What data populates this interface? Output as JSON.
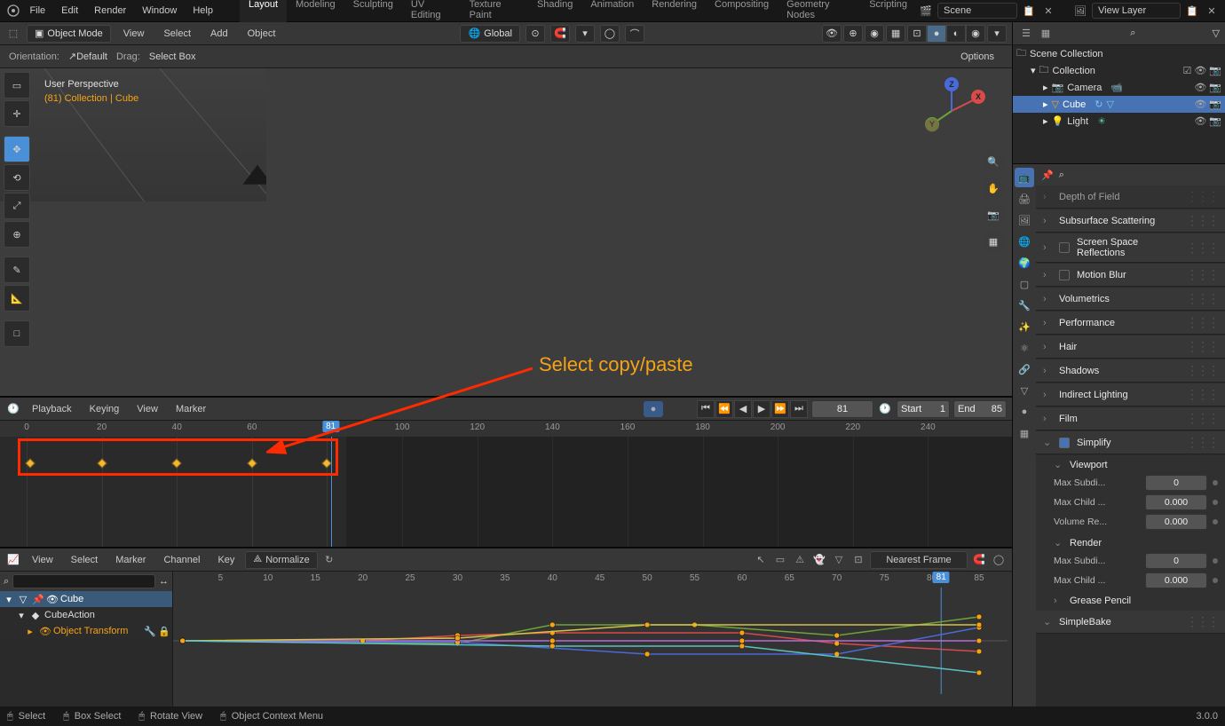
{
  "topbar": {
    "menus": [
      "File",
      "Edit",
      "Render",
      "Window",
      "Help"
    ],
    "tabs": [
      "Layout",
      "Modeling",
      "Sculpting",
      "UV Editing",
      "Texture Paint",
      "Shading",
      "Animation",
      "Rendering",
      "Compositing",
      "Geometry Nodes",
      "Scripting"
    ],
    "active_tab": 0,
    "scene_label": "Scene",
    "viewlayer_label": "View Layer"
  },
  "header3d": {
    "mode": "Object Mode",
    "menus": [
      "View",
      "Select",
      "Add",
      "Object"
    ],
    "orientation": "Global",
    "orientation_label": "Orientation:",
    "orientation_value": "Default",
    "drag_label": "Drag:",
    "drag_value": "Select Box",
    "options": "Options"
  },
  "overlay": {
    "line1": "User Perspective",
    "line2": "(81) Collection | Cube"
  },
  "timeline": {
    "menus": [
      "Playback",
      "Keying",
      "View",
      "Marker"
    ],
    "current_frame": "81",
    "start_label": "Start",
    "start_value": "1",
    "end_label": "End",
    "end_value": "85",
    "ruler_ticks": [
      0,
      20,
      40,
      60,
      80,
      100,
      120,
      140,
      160,
      180,
      200,
      220,
      240
    ],
    "keyframes": [
      1,
      20,
      40,
      60,
      80
    ],
    "playhead": 81
  },
  "graph": {
    "menus": [
      "View",
      "Select",
      "Marker",
      "Channel",
      "Key"
    ],
    "normalize": "Normalize",
    "snap_mode": "Nearest Frame",
    "ruler_ticks": [
      5,
      10,
      15,
      20,
      25,
      30,
      35,
      40,
      45,
      50,
      55,
      60,
      65,
      70,
      75,
      80,
      85
    ],
    "side": {
      "object": "Cube",
      "action": "CubeAction",
      "group": "Object Transform"
    }
  },
  "outliner": {
    "root": "Scene Collection",
    "collection": "Collection",
    "items": [
      "Camera",
      "Cube",
      "Light"
    ],
    "selected": 1
  },
  "properties": {
    "panels": [
      {
        "title": "Depth of Field",
        "collapsed": true,
        "dim": true
      },
      {
        "title": "Subsurface Scattering",
        "collapsed": true
      },
      {
        "title": "Screen Space Reflections",
        "collapsed": true,
        "checkbox": true,
        "indent": true
      },
      {
        "title": "Motion Blur",
        "collapsed": true,
        "checkbox": true
      },
      {
        "title": "Volumetrics",
        "collapsed": true
      },
      {
        "title": "Performance",
        "collapsed": true
      },
      {
        "title": "Hair",
        "collapsed": true
      },
      {
        "title": "Shadows",
        "collapsed": true
      },
      {
        "title": "Indirect Lighting",
        "collapsed": true
      },
      {
        "title": "Film",
        "collapsed": true
      }
    ],
    "simplify": {
      "title": "Simplify",
      "viewport_title": "Viewport",
      "render_title": "Render",
      "max_subdiv_label": "Max Subdi...",
      "max_child_label": "Max Child ...",
      "volume_label": "Volume Re...",
      "vp_subdiv": "0",
      "vp_child": "0.000",
      "vp_volume": "0.000",
      "r_subdiv": "0",
      "r_child": "0.000"
    },
    "grease": "Grease Pencil",
    "simplebake": "SimpleBake"
  },
  "statusbar": {
    "select": "Select",
    "box": "Box Select",
    "rotate": "Rotate View",
    "ctx": "Object Context Menu",
    "version": "3.0.0"
  },
  "annotation": {
    "text": "Select copy/paste"
  },
  "icons": {
    "search": "⌕",
    "filter": "▽"
  }
}
